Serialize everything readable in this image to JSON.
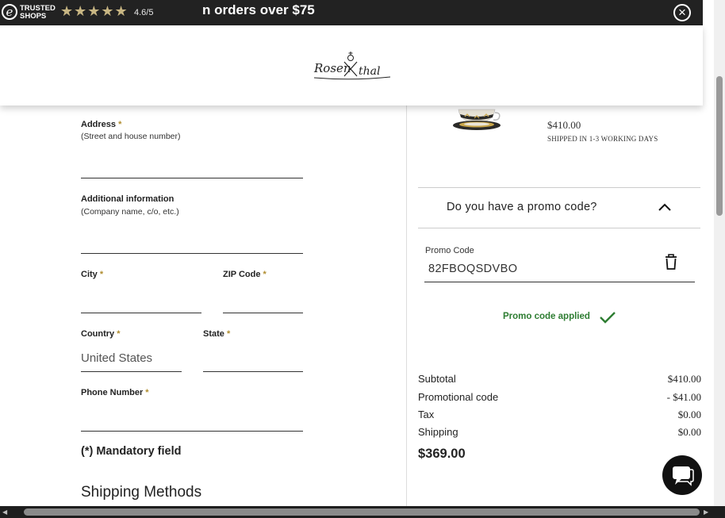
{
  "banner": {
    "trusted_logo_letter": "e",
    "trusted_label_line1": "TRUSTED",
    "trusted_label_line2": "SHOPS",
    "stars": "★★★★★",
    "rating": "4.6/5",
    "message": "n orders over $75",
    "close_icon": "close-icon"
  },
  "header": {
    "logo_text": "Rosenthal"
  },
  "product": {
    "price": "$410.00",
    "shipping": "SHIPPED IN 1-3 WORKING DAYS"
  },
  "form": {
    "address_label": "Address",
    "address_hint": "(Street and house number)",
    "additional_label": "Additional information",
    "additional_hint": "(Company name, c/o, etc.)",
    "city_label": "City",
    "zip_label": "ZIP Code",
    "country_label": "Country",
    "country_value": "United States",
    "state_label": "State",
    "phone_label": "Phone Number",
    "required_marker": "*",
    "mandatory_note": "(*) Mandatory field",
    "shipping_methods": "Shipping Methods"
  },
  "promo": {
    "question": "Do you have a promo code?",
    "code_label": "Promo Code",
    "code_value": "82FBOQSDVBO",
    "applied_text": "Promo code applied"
  },
  "summary": {
    "rows": [
      {
        "label": "Subtotal",
        "value": "$410.00"
      },
      {
        "label": "Promotional code",
        "value": "- $41.00"
      },
      {
        "label": "Tax",
        "value": "$0.00"
      },
      {
        "label": "Shipping",
        "value": "$0.00"
      }
    ],
    "total": "$369.00"
  },
  "colors": {
    "banner_bg": "#222222",
    "star_color": "#c8b683",
    "required_color": "#b08d2f",
    "applied_green": "#2e7d32"
  }
}
